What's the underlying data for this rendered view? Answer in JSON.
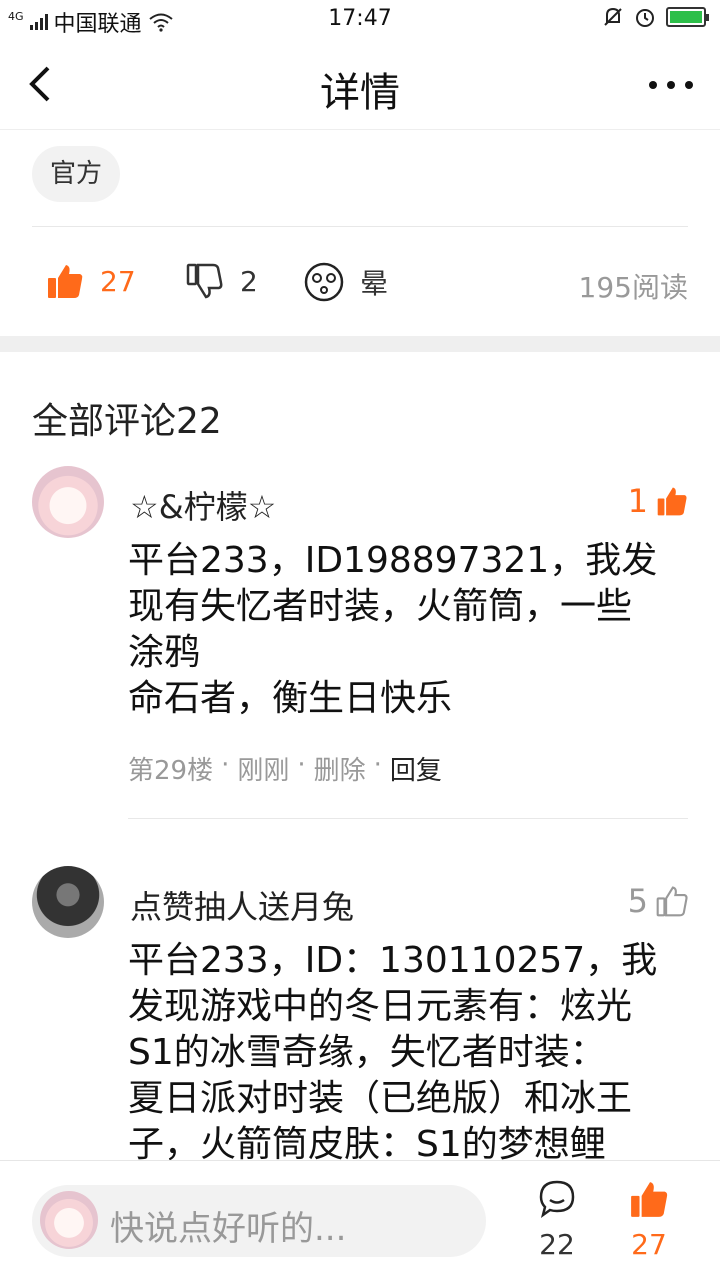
{
  "status_bar": {
    "network": "4G",
    "carrier": "中国联通",
    "time": "17:47"
  },
  "nav": {
    "title": "详情"
  },
  "post": {
    "tag": "官方",
    "likes": "27",
    "dislikes": "2",
    "reaction_label": "晕",
    "reads": "195阅读"
  },
  "comments_section": {
    "header": "全部评论22"
  },
  "comments": [
    {
      "name": "☆&柠檬☆",
      "likes": "1",
      "lines": [
        "平台233，ID198897321，我发",
        "现有失忆者时装，火箭筒，一些",
        "涂鸦",
        "命石者，衡生日快乐"
      ],
      "floor": "第29楼",
      "time": "刚刚",
      "delete": "删除",
      "reply": "回复"
    },
    {
      "name": "点赞抽人送月兔",
      "likes": "5",
      "lines": [
        "平台233，ID：130110257，我",
        "发现游戏中的冬日元素有：炫光",
        "S1的冰雪奇缘，失忆者时装：",
        "夏日派对时装（已绝版）和冰王",
        "子，火箭筒皮肤：S1的梦想鲤"
      ]
    }
  ],
  "bottom_bar": {
    "placeholder": "快说点好听的...",
    "comment_count": "22",
    "like_count": "27"
  },
  "colors": {
    "accent": "#ff6a1a",
    "muted": "#999999"
  }
}
